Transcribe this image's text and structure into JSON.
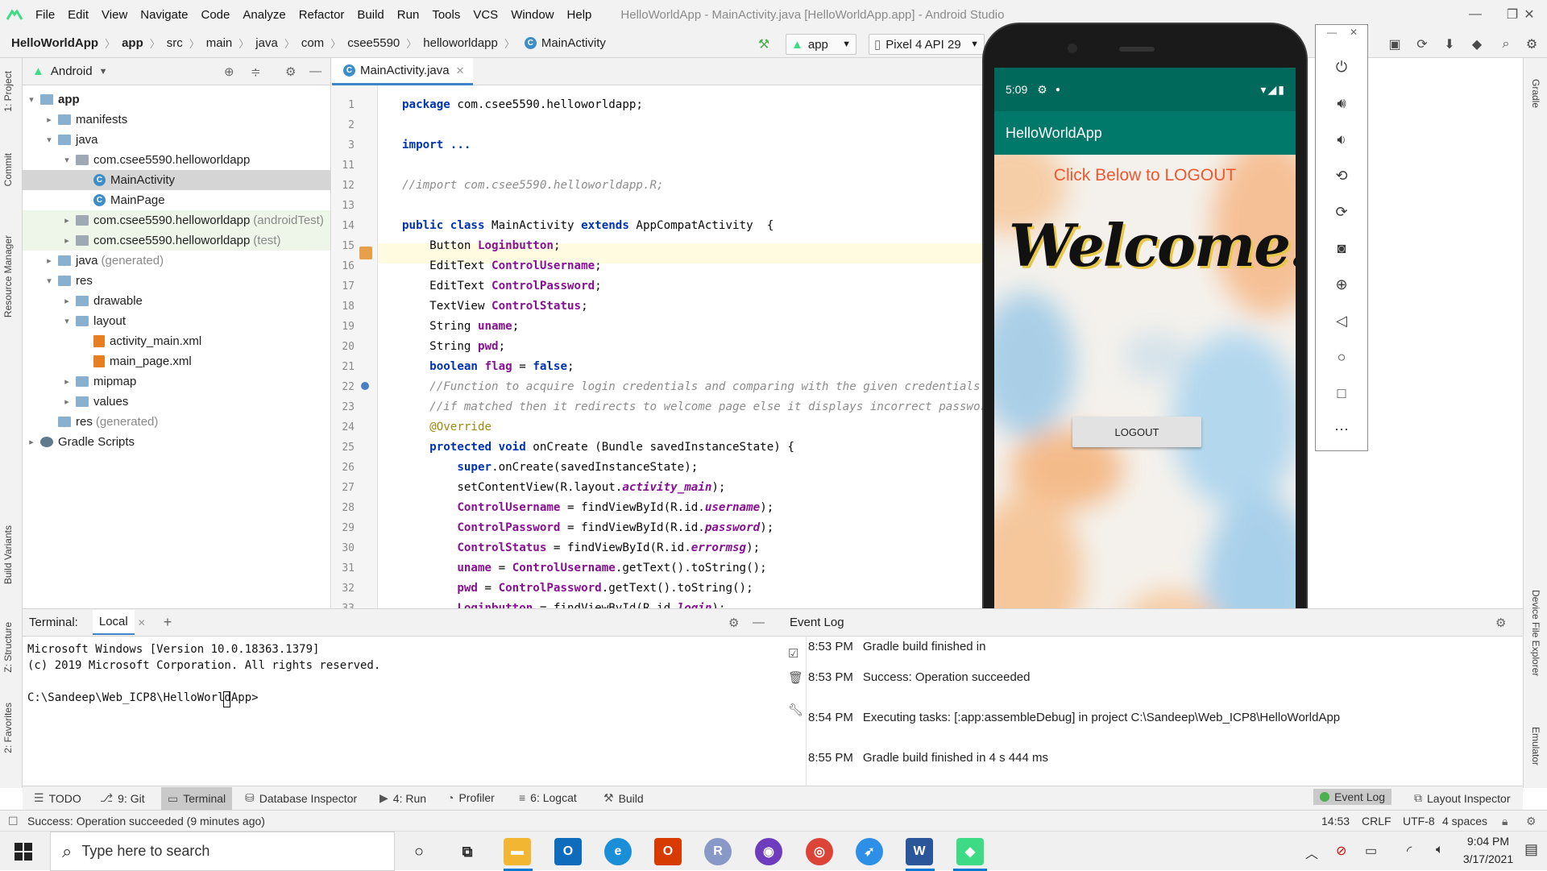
{
  "menubar": {
    "items": [
      "File",
      "Edit",
      "View",
      "Navigate",
      "Code",
      "Analyze",
      "Refactor",
      "Build",
      "Run",
      "Tools",
      "VCS",
      "Window",
      "Help"
    ],
    "title": "HelloWorldApp - MainActivity.java [HelloWorldApp.app] - Android Studio"
  },
  "breadcrumb": [
    "HelloWorldApp",
    "app",
    "src",
    "main",
    "java",
    "com",
    "csee5590",
    "helloworldapp",
    "MainActivity"
  ],
  "toolbar": {
    "config": "app",
    "device": "Pixel 4 API 29"
  },
  "project": {
    "view_label": "Android",
    "tree": [
      {
        "label": "app",
        "indent": 0,
        "arrow": "▾",
        "icon": "folder",
        "bold": true
      },
      {
        "label": "manifests",
        "indent": 1,
        "arrow": "▸",
        "icon": "folder"
      },
      {
        "label": "java",
        "indent": 1,
        "arrow": "▾",
        "icon": "folder"
      },
      {
        "label": "com.csee5590.helloworldapp",
        "indent": 2,
        "arrow": "▾",
        "icon": "pkg"
      },
      {
        "label": "MainActivity",
        "indent": 3,
        "arrow": "",
        "icon": "class",
        "selected": true
      },
      {
        "label": "MainPage",
        "indent": 3,
        "arrow": "",
        "icon": "class"
      },
      {
        "label": "com.csee5590.helloworldapp",
        "suffix": "(androidTest)",
        "indent": 2,
        "arrow": "▸",
        "icon": "pkg",
        "green": true
      },
      {
        "label": "com.csee5590.helloworldapp",
        "suffix": "(test)",
        "indent": 2,
        "arrow": "▸",
        "icon": "pkg",
        "green": true
      },
      {
        "label": "java",
        "suffix": "(generated)",
        "indent": 1,
        "arrow": "▸",
        "icon": "folder"
      },
      {
        "label": "res",
        "indent": 1,
        "arrow": "▾",
        "icon": "folder"
      },
      {
        "label": "drawable",
        "indent": 2,
        "arrow": "▸",
        "icon": "folder"
      },
      {
        "label": "layout",
        "indent": 2,
        "arrow": "▾",
        "icon": "folder"
      },
      {
        "label": "activity_main.xml",
        "indent": 3,
        "arrow": "",
        "icon": "xml"
      },
      {
        "label": "main_page.xml",
        "indent": 3,
        "arrow": "",
        "icon": "xml"
      },
      {
        "label": "mipmap",
        "indent": 2,
        "arrow": "▸",
        "icon": "folder"
      },
      {
        "label": "values",
        "indent": 2,
        "arrow": "▸",
        "icon": "folder"
      },
      {
        "label": "res",
        "suffix": "(generated)",
        "indent": 1,
        "arrow": "",
        "icon": "folder"
      },
      {
        "label": "Gradle Scripts",
        "indent": 0,
        "arrow": "▸",
        "icon": "gradle"
      }
    ]
  },
  "editor": {
    "tab_label": "MainActivity.java",
    "lines": [
      {
        "n": "1",
        "html": "<span class='kw'>package</span> com.csee5590.helloworldapp;"
      },
      {
        "n": "2",
        "html": ""
      },
      {
        "n": "3",
        "html": "<span class='kw'>import</span> <span class='kw'>...</span>"
      },
      {
        "n": "11",
        "html": ""
      },
      {
        "n": "12",
        "html": "<span class='cmt'>//import com.csee5590.helloworldapp.R;</span>"
      },
      {
        "n": "13",
        "html": ""
      },
      {
        "n": "14",
        "html": "<span class='kw'>public class</span> MainActivity <span class='kw'>extends</span> AppCompatActivity  {"
      },
      {
        "n": "15",
        "html": "    Button <span class='fld'>Loginbutton</span>;"
      },
      {
        "n": "16",
        "html": "    EditText <span class='fld'>ControlUsername</span>;"
      },
      {
        "n": "17",
        "html": "    EditText <span class='fld'>ControlPassword</span>;"
      },
      {
        "n": "18",
        "html": "    TextView <span class='fld'>ControlStatus</span>;"
      },
      {
        "n": "19",
        "html": "    String <span class='fld'>uname</span>;"
      },
      {
        "n": "20",
        "html": "    String <span class='fld'>pwd</span>;"
      },
      {
        "n": "21",
        "html": "    <span class='kw'>boolean</span> <span class='fld'>flag</span> = <span class='kw'>false</span>;"
      },
      {
        "n": "22",
        "html": "    <span class='cmt'>//Function to acquire login credentials and comparing with the given credentials</span>"
      },
      {
        "n": "23",
        "html": "    <span class='cmt'>//if matched then it redirects to welcome page else it displays incorrect password</span>"
      },
      {
        "n": "24",
        "html": "    <span class='ann'>@Override</span>"
      },
      {
        "n": "25",
        "html": "    <span class='kw'>protected void</span> onCreate (Bundle savedInstanceState) {"
      },
      {
        "n": "26",
        "html": "        <span class='kw'>super</span>.onCreate(savedInstanceState);"
      },
      {
        "n": "27",
        "html": "        setContentView(R.layout.<span class='ital'>activity_main</span>);"
      },
      {
        "n": "28",
        "html": "        <span class='fld'>ControlUsername</span> = findViewById(R.id.<span class='ital'>username</span>);"
      },
      {
        "n": "29",
        "html": "        <span class='fld'>ControlPassword</span> = findViewById(R.id.<span class='ital'>password</span>);"
      },
      {
        "n": "30",
        "html": "        <span class='fld'>ControlStatus</span> = findViewById(R.id.<span class='ital'>errormsg</span>);"
      },
      {
        "n": "31",
        "html": "        <span class='fld'>uname</span> = <span class='fld'>ControlUsername</span>.getText().toString();"
      },
      {
        "n": "32",
        "html": "        <span class='fld'>pwd</span> = <span class='fld'>ControlPassword</span>.getText().toString();"
      },
      {
        "n": "33",
        "html": "        <span class='fld'>Loginbutton</span> = findViewById(R.id.<span class='ital'>login</span>);"
      }
    ]
  },
  "terminal": {
    "label": "Terminal:",
    "tab": "Local",
    "lines": [
      "Microsoft Windows [Version 10.0.18363.1379]",
      "(c) 2019 Microsoft Corporation. All rights reserved.",
      "",
      "C:\\Sandeep\\Web_ICP8\\HelloWorldApp>"
    ]
  },
  "eventlog": {
    "title": "Event Log",
    "entries": [
      {
        "time": "8:53 PM",
        "text": "Gradle build finished in"
      },
      {
        "time": "8:53 PM",
        "text": "Success: Operation succeeded"
      },
      {
        "time": "8:54 PM",
        "text": "Executing tasks: [:app:assembleDebug] in project C:\\Sandeep\\Web_ICP8\\HelloWorldApp"
      },
      {
        "time": "8:55 PM",
        "text": "Gradle build finished in 4 s 444 ms"
      }
    ]
  },
  "toolwindows": [
    "TODO",
    "9: Git",
    "Terminal",
    "Database Inspector",
    "4: Run",
    "Profiler",
    "6: Logcat",
    "Build"
  ],
  "toolwindows_right": [
    "Event Log",
    "Layout Inspector"
  ],
  "left_vtabs": [
    "1: Project",
    "Commit",
    "Resource Manager",
    "Build Variants",
    "Z: Structure",
    "2: Favorites"
  ],
  "right_vtabs": [
    "Gradle",
    "Device File Explorer",
    "Emulator"
  ],
  "status": {
    "message": "Success: Operation succeeded (9 minutes ago)",
    "pos": "14:53",
    "eol": "CRLF",
    "enc": "UTF-8",
    "indent": "4 spaces"
  },
  "taskbar": {
    "search_placeholder": "Type here to search",
    "time": "9:04 PM",
    "date": "3/17/2021"
  },
  "phone": {
    "status_time": "5:09",
    "app_title": "HelloWorldApp",
    "heading": "Click Below to LOGOUT",
    "welcome": "Welcome!",
    "button": "LOGOUT",
    "appbar_color": "#00796b"
  }
}
